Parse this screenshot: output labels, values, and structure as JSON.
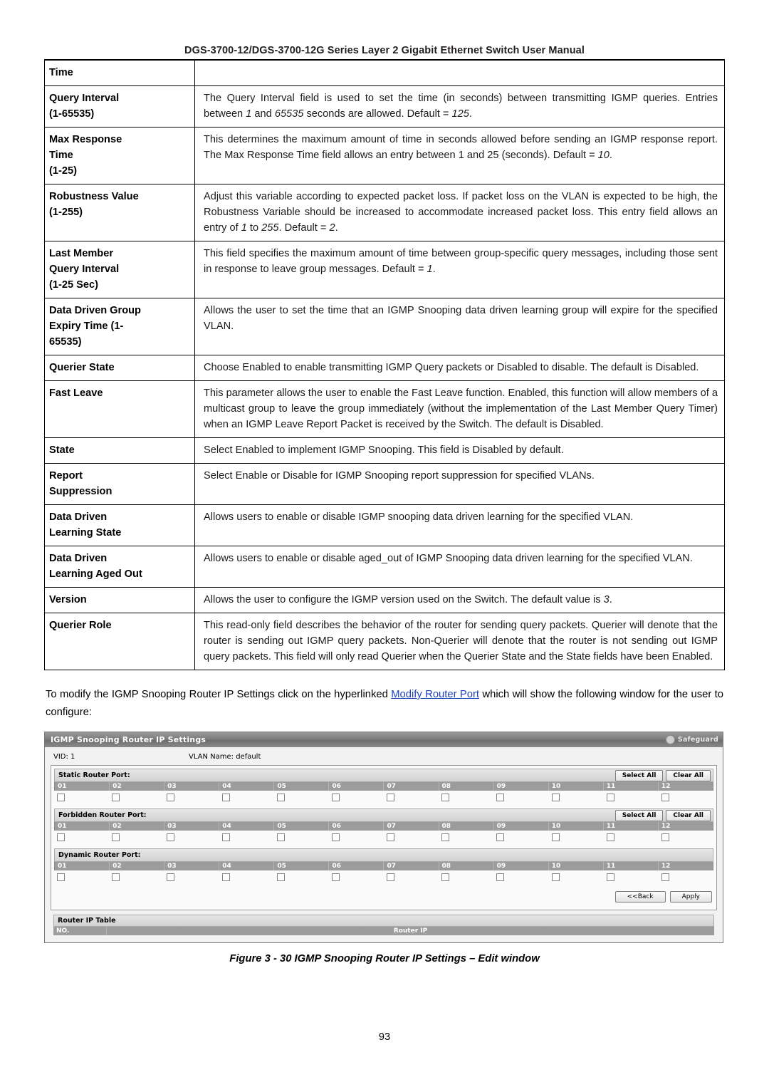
{
  "header": {
    "title": "DGS-3700-12/DGS-3700-12G Series Layer 2 Gigabit Ethernet Switch User Manual"
  },
  "param_table": {
    "rows": [
      {
        "label": [
          "Time"
        ],
        "desc": ""
      },
      {
        "label": [
          "Query Interval",
          "(1-65535)"
        ],
        "desc": "The Query Interval field is used to set the time (in seconds) between transmitting IGMP queries. Entries between 1 and 65535 seconds are allowed. Default = 125."
      },
      {
        "label": [
          "Max Response",
          "Time",
          "(1-25)"
        ],
        "desc": "This determines the maximum amount of time in seconds allowed before sending an IGMP response report. The Max Response Time field allows an entry between 1 and 25 (seconds). Default = 10."
      },
      {
        "label": [
          "Robustness Value",
          "(1-255)"
        ],
        "desc": "Adjust this variable according to expected packet loss. If packet loss on the VLAN is expected to be high, the Robustness Variable should be increased to accommodate increased packet loss. This entry field allows an entry of 1 to 255. Default = 2."
      },
      {
        "label": [
          "Last Member",
          "Query Interval",
          "(1-25 Sec)"
        ],
        "desc": "This field specifies the maximum amount of time between group-specific query messages, including those sent in response to leave group messages. Default = 1."
      },
      {
        "label": [
          "Data Driven Group",
          "Expiry Time (1-",
          "65535)"
        ],
        "desc": "Allows the user to set the time that an IGMP Snooping data driven learning group will expire for the specified VLAN."
      },
      {
        "label": [
          "Querier State"
        ],
        "desc": "Choose Enabled to enable transmitting IGMP Query packets or Disabled to disable. The default is Disabled."
      },
      {
        "label": [
          "Fast Leave"
        ],
        "desc": "This parameter allows the user to enable the Fast Leave function. Enabled, this function will allow members of a multicast group to leave the group immediately (without the implementation of the Last Member Query Timer) when an IGMP Leave Report Packet is received by the Switch. The default is Disabled."
      },
      {
        "label": [
          "State"
        ],
        "desc": "Select Enabled to implement IGMP Snooping. This field is Disabled by default."
      },
      {
        "label": [
          "Report",
          "Suppression"
        ],
        "desc": "Select Enable or Disable for IGMP Snooping report suppression for specified VLANs."
      },
      {
        "label": [
          "Data Driven",
          "Learning State"
        ],
        "desc": "Allows users to enable or disable IGMP snooping data driven learning for the specified VLAN."
      },
      {
        "label": [
          "Data Driven",
          "Learning Aged Out"
        ],
        "desc": "Allows users to enable or disable aged_out of IGMP Snooping data driven learning for the specified VLAN."
      },
      {
        "label": [
          "Version"
        ],
        "desc": "Allows the user to configure the IGMP version used on the Switch. The default value is 3."
      },
      {
        "label": [
          "Querier Role"
        ],
        "desc": "This read-only field describes the behavior of the router for sending query packets. Querier will denote that the router is sending out IGMP query packets. Non-Querier will denote that the router is not sending out IGMP query packets. This field will only read Querier when the Querier State and the State fields have been Enabled."
      }
    ]
  },
  "paragraph": {
    "before": "To modify the IGMP Snooping Router IP Settings click on the hyperlinked ",
    "link": "Modify Router Port",
    "after": " which will show the following window for the user to configure:"
  },
  "screenshot": {
    "title": "IGMP Snooping Router IP Settings",
    "safeguard": "Safeguard",
    "vid_label": "VID: 1",
    "vlan_name_label": "VLAN Name:  default",
    "sections": [
      {
        "title": "Static Router Port:",
        "select_all": "Select All",
        "clear_all": "Clear All",
        "ports": [
          "01",
          "02",
          "03",
          "04",
          "05",
          "06",
          "07",
          "08",
          "09",
          "10",
          "11",
          "12"
        ]
      },
      {
        "title": "Forbidden Router Port:",
        "select_all": "Select All",
        "clear_all": "Clear All",
        "ports": [
          "01",
          "02",
          "03",
          "04",
          "05",
          "06",
          "07",
          "08",
          "09",
          "10",
          "11",
          "12"
        ]
      },
      {
        "title": "Dynamic Router Port:",
        "select_all": "",
        "clear_all": "",
        "ports": [
          "01",
          "02",
          "03",
          "04",
          "05",
          "06",
          "07",
          "08",
          "09",
          "10",
          "11",
          "12"
        ]
      }
    ],
    "back_button": "<<Back",
    "apply_button": "Apply",
    "router_ip_table_title": "Router IP Table",
    "table_col_no": "NO.",
    "table_col_router_ip": "Router IP"
  },
  "figure_caption": "Figure 3 - 30 IGMP Snooping Router IP Settings – Edit window",
  "page_number": "93"
}
